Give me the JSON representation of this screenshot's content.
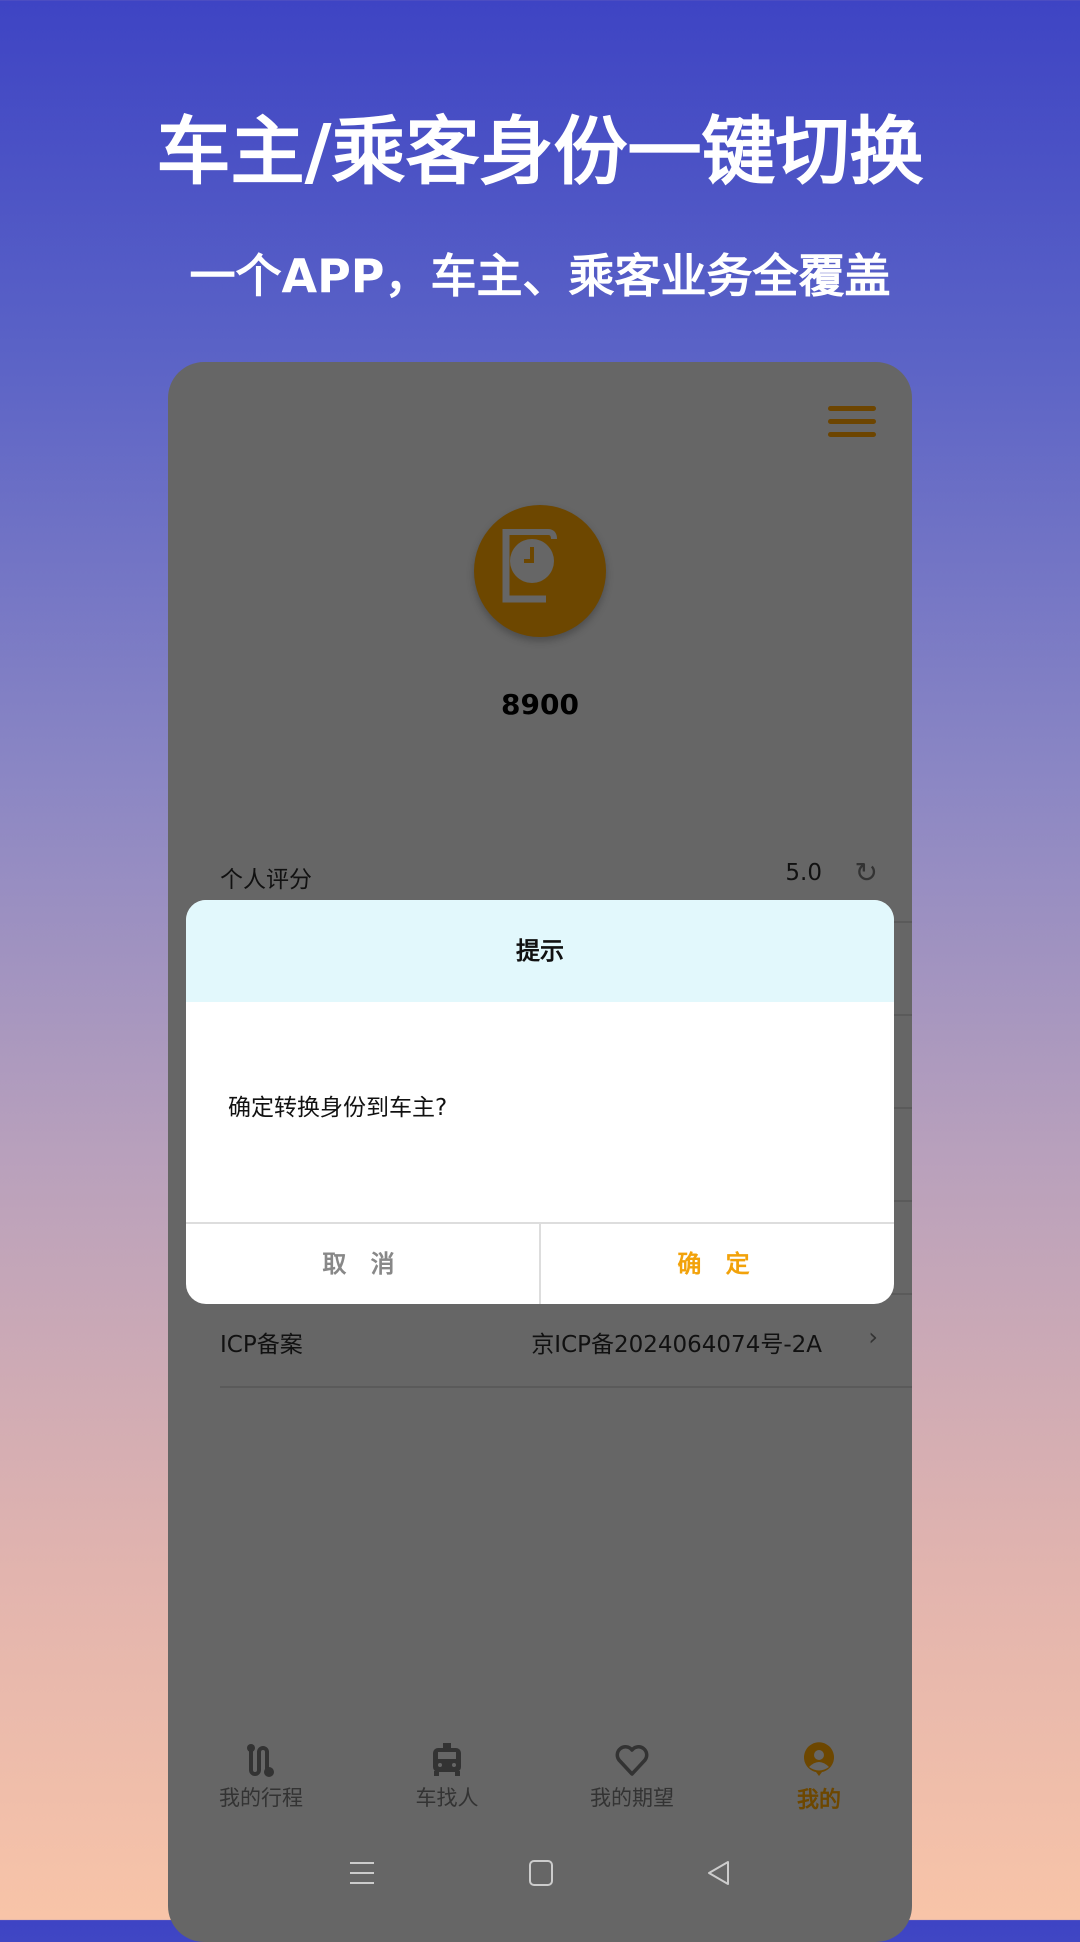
{
  "promo": {
    "title": "车主/乘客身份一键切换",
    "subtitle": "一个APP，车主、乘客业务全覆盖"
  },
  "profile": {
    "username": "8900"
  },
  "rows": [
    {
      "label": "个人评分",
      "value": "5.0",
      "icon": "refresh-icon"
    },
    {
      "label": "ICP备案",
      "value": "京ICP备2024064074号-2A",
      "icon": "chevron-right-icon"
    }
  ],
  "dialog": {
    "title": "提示",
    "message": "确定转换身份到车主?",
    "cancel": "取 消",
    "confirm": "确 定"
  },
  "nav": [
    {
      "label": "我的行程",
      "icon": "route-icon"
    },
    {
      "label": "车找人",
      "icon": "taxi-icon"
    },
    {
      "label": "我的期望",
      "icon": "heart-icon"
    },
    {
      "label": "我的",
      "icon": "person-icon",
      "active": true
    }
  ],
  "colors": {
    "accent": "#f2a20a",
    "active_dimmed": "#6d4700",
    "dialog_header": "#e2f8fc"
  }
}
